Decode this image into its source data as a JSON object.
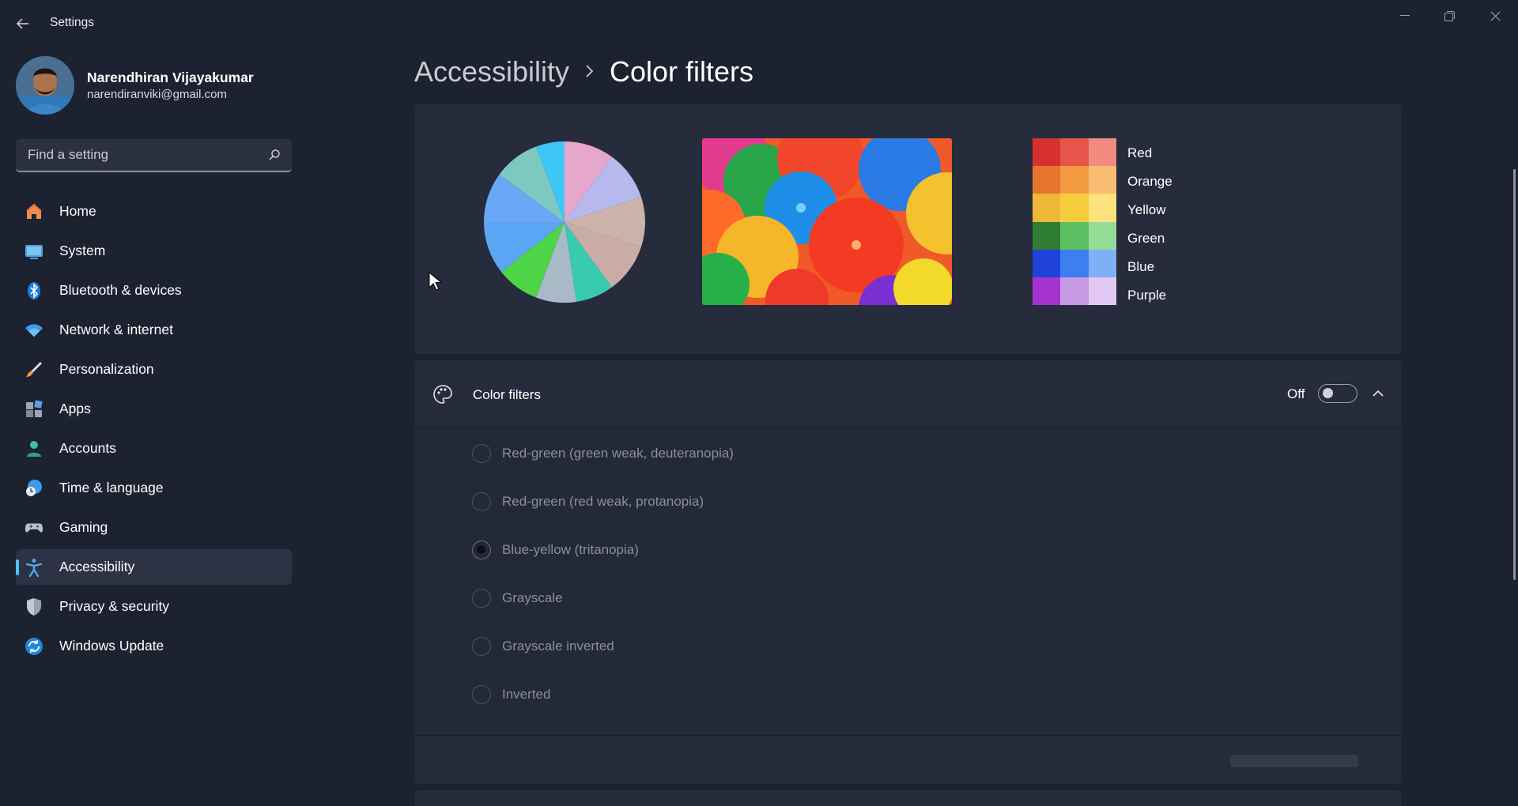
{
  "window": {
    "title": "Settings"
  },
  "user": {
    "name": "Narendhiran Vijayakumar",
    "email": "narendiranviki@gmail.com"
  },
  "search": {
    "placeholder": "Find a setting"
  },
  "nav": {
    "items": [
      {
        "label": "Home",
        "icon": "home-icon"
      },
      {
        "label": "System",
        "icon": "system-icon"
      },
      {
        "label": "Bluetooth & devices",
        "icon": "bluetooth-icon"
      },
      {
        "label": "Network & internet",
        "icon": "wifi-icon"
      },
      {
        "label": "Personalization",
        "icon": "brush-icon"
      },
      {
        "label": "Apps",
        "icon": "apps-icon"
      },
      {
        "label": "Accounts",
        "icon": "accounts-icon"
      },
      {
        "label": "Time & language",
        "icon": "time-language-icon"
      },
      {
        "label": "Gaming",
        "icon": "gaming-icon"
      },
      {
        "label": "Accessibility",
        "icon": "accessibility-icon",
        "active": true
      },
      {
        "label": "Privacy & security",
        "icon": "shield-icon"
      },
      {
        "label": "Windows Update",
        "icon": "update-icon"
      }
    ]
  },
  "breadcrumb": {
    "parent": "Accessibility",
    "current": "Color filters"
  },
  "preview": {
    "palette": [
      {
        "name": "Red",
        "swatches": [
          "#d6312f",
          "#e5554a",
          "#f08b82"
        ]
      },
      {
        "name": "Orange",
        "swatches": [
          "#e5742f",
          "#f29a3f",
          "#f7bc72"
        ]
      },
      {
        "name": "Yellow",
        "swatches": [
          "#ecb836",
          "#f7cd3d",
          "#fbe27a"
        ]
      },
      {
        "name": "Green",
        "swatches": [
          "#2e7d32",
          "#5dbf63",
          "#95dc98"
        ]
      },
      {
        "name": "Blue",
        "swatches": [
          "#1f42d8",
          "#3f7ef0",
          "#7fb0f6"
        ]
      },
      {
        "name": "Purple",
        "swatches": [
          "#a533d0",
          "#c79ae6",
          "#e1c8f2"
        ]
      }
    ]
  },
  "color_filters": {
    "title": "Color filters",
    "toggle_state": "Off",
    "toggle_on": false,
    "options": [
      {
        "label": "Red-green (green weak, deuteranopia)",
        "checked": false
      },
      {
        "label": "Red-green (red weak, protanopia)",
        "checked": false
      },
      {
        "label": "Blue-yellow (tritanopia)",
        "checked": true
      },
      {
        "label": "Grayscale",
        "checked": false
      },
      {
        "label": "Grayscale inverted",
        "checked": false
      },
      {
        "label": "Inverted",
        "checked": false
      }
    ]
  },
  "colors": {
    "accent": "#4cc2ff",
    "background": "#1c2230",
    "card": "#262c3b"
  }
}
